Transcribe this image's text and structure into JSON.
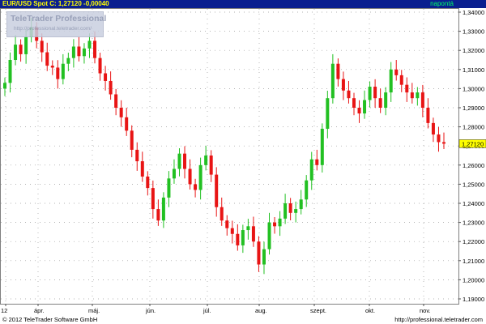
{
  "header": {
    "symbol_quote": "EUR/USD Spot  C: 1,27120  -0,00040",
    "period": "napontá"
  },
  "watermark": {
    "title": "TeleTrader Professional",
    "url": "http://professional.teletrader.com/"
  },
  "footer": {
    "copyright": "© 2012 TeleTrader Software GmbH",
    "url": "http://professional.teletrader.com"
  },
  "colors": {
    "up": "#22c022",
    "down": "#e81414",
    "header_bg": "#0a1f8f",
    "last_price_bg": "#ffff00"
  },
  "chart_data": {
    "type": "candlestick",
    "title": "EUR/USD Spot",
    "ylim": [
      1.19,
      1.34
    ],
    "y_ticks": [
      "1,34000",
      "1,33000",
      "1,32000",
      "1,31000",
      "1,30000",
      "1,29000",
      "1,28000",
      "1,27000",
      "1,26000",
      "1,25000",
      "1,24000",
      "1,23000",
      "1,22000",
      "1,21000",
      "1,20000",
      "1,19000"
    ],
    "last_price": "1,27120",
    "x_labels": [
      "12",
      "ápr.",
      "máj.",
      "jún.",
      "júl.",
      "aug.",
      "szept.",
      "okt.",
      "nov."
    ],
    "grid": true,
    "legend": "none",
    "closes": [
      1.303,
      1.315,
      1.323,
      1.318,
      1.327,
      1.332,
      1.325,
      1.319,
      1.312,
      1.311,
      1.305,
      1.313,
      1.316,
      1.322,
      1.317,
      1.321,
      1.325,
      1.316,
      1.308,
      1.304,
      1.297,
      1.29,
      1.285,
      1.278,
      1.268,
      1.262,
      1.254,
      1.248,
      1.237,
      1.231,
      1.243,
      1.253,
      1.258,
      1.266,
      1.258,
      1.25,
      1.247,
      1.26,
      1.265,
      1.255,
      1.238,
      1.231,
      1.227,
      1.224,
      1.218,
      1.226,
      1.228,
      1.22,
      1.208,
      1.216,
      1.23,
      1.228,
      1.232,
      1.24,
      1.235,
      1.237,
      1.242,
      1.252,
      1.263,
      1.26,
      1.279,
      1.295,
      1.313,
      1.305,
      1.299,
      1.295,
      1.29,
      1.287,
      1.294,
      1.301,
      1.295,
      1.29,
      1.298,
      1.31,
      1.307,
      1.302,
      1.298,
      1.295,
      1.298,
      1.29,
      1.282,
      1.276,
      1.272,
      1.2712
    ]
  }
}
